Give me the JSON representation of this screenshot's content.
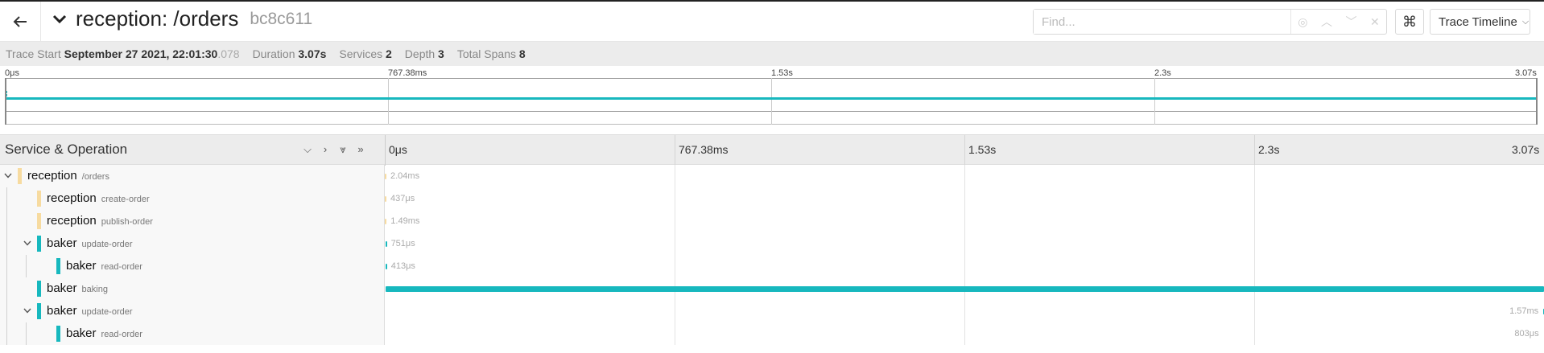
{
  "header": {
    "title": "reception: /orders",
    "trace_id": "bc8c611",
    "find_placeholder": "Find...",
    "view_label": "Trace Timeline",
    "cmd_label": "⌘"
  },
  "summary": {
    "trace_start_label": "Trace Start",
    "trace_start_value": "September 27 2021, 22:01:30",
    "trace_start_ms": ".078",
    "duration_label": "Duration",
    "duration_value": "3.07s",
    "services_label": "Services",
    "services_value": "2",
    "depth_label": "Depth",
    "depth_value": "3",
    "total_spans_label": "Total Spans",
    "total_spans_value": "8"
  },
  "minimap": {
    "ticks": [
      "0μs",
      "767.38ms",
      "1.53s",
      "2.3s",
      "3.07s"
    ]
  },
  "timeline": {
    "column_title": "Service & Operation",
    "ticks": [
      "0μs",
      "767.38ms",
      "1.53s",
      "2.3s",
      "3.07s"
    ]
  },
  "colors": {
    "reception": "#f7dba0",
    "baker": "#17b8be"
  },
  "spans": [
    {
      "service": "reception",
      "operation": "/orders",
      "duration": "2.04ms",
      "depth": 0,
      "has_children": true,
      "start_frac": 0.0,
      "dur_frac": 0.0007
    },
    {
      "service": "reception",
      "operation": "create-order",
      "duration": "437μs",
      "depth": 1,
      "has_children": false,
      "start_frac": 0.0,
      "dur_frac": 0.0002
    },
    {
      "service": "reception",
      "operation": "publish-order",
      "duration": "1.49ms",
      "depth": 1,
      "has_children": false,
      "start_frac": 0.0002,
      "dur_frac": 0.0005
    },
    {
      "service": "baker",
      "operation": "update-order",
      "duration": "751μs",
      "depth": 1,
      "has_children": true,
      "start_frac": 0.0004,
      "dur_frac": 0.0003
    },
    {
      "service": "baker",
      "operation": "read-order",
      "duration": "413μs",
      "depth": 2,
      "has_children": false,
      "start_frac": 0.0005,
      "dur_frac": 0.0002
    },
    {
      "service": "baker",
      "operation": "baking",
      "duration": "",
      "depth": 1,
      "has_children": false,
      "start_frac": 0.0006,
      "dur_frac": 0.9994
    },
    {
      "service": "baker",
      "operation": "update-order",
      "duration": "1.57ms",
      "depth": 1,
      "has_children": true,
      "start_frac": 0.9994,
      "dur_frac": 0.0005
    },
    {
      "service": "baker",
      "operation": "read-order",
      "duration": "803μs",
      "depth": 2,
      "has_children": false,
      "start_frac": 0.9997,
      "dur_frac": 0.0003
    }
  ]
}
